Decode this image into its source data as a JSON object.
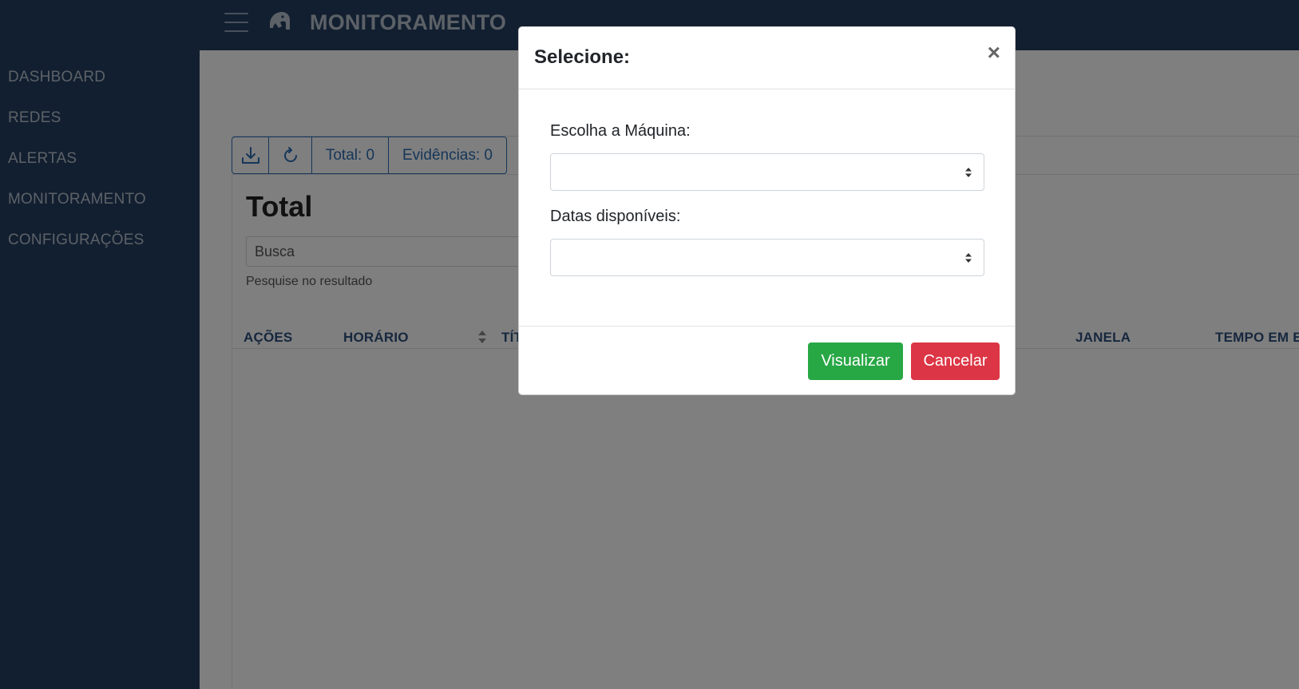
{
  "header": {
    "title": "MONITORAMENTO",
    "menu_icon": "hamburger-menu-icon",
    "logo_icon": "horse-head-logo-icon"
  },
  "sidebar": {
    "items": [
      {
        "label": "DASHBOARD"
      },
      {
        "label": "REDES"
      },
      {
        "label": "ALERTAS"
      },
      {
        "label": "MONITORAMENTO"
      },
      {
        "label": "CONFIGURAÇÕES"
      }
    ]
  },
  "toolbar": {
    "download_icon": "download-icon",
    "refresh_icon": "refresh-icon",
    "total_label": "Total: 0",
    "evidencias_label": "Evidências: 0"
  },
  "main": {
    "section_title": "Total",
    "search": {
      "placeholder": "Busca",
      "help": "Pesquise no resultado"
    },
    "table": {
      "columns": [
        "AÇÕES",
        "HORÁRIO",
        "TÍTULO",
        "JANELA",
        "TEMPO EM EXECUÇÃO"
      ],
      "visible_columns": [
        "AÇÕES",
        "HORÁRIO",
        "TÍT",
        "JANELA",
        "TEMPO EM EX"
      ]
    }
  },
  "modal": {
    "title": "Selecione:",
    "close_symbol": "×",
    "fields": [
      {
        "label": "Escolha a Máquina:",
        "value": ""
      },
      {
        "label": "Datas disponíveis:",
        "value": ""
      }
    ],
    "buttons": {
      "confirm": "Visualizar",
      "cancel": "Cancelar"
    }
  },
  "colors": {
    "navbar": "#243f61",
    "accent_blue": "#2c6db3",
    "success": "#28a745",
    "danger": "#dc3545",
    "backdrop": "rgba(0,0,0,0.5)"
  }
}
